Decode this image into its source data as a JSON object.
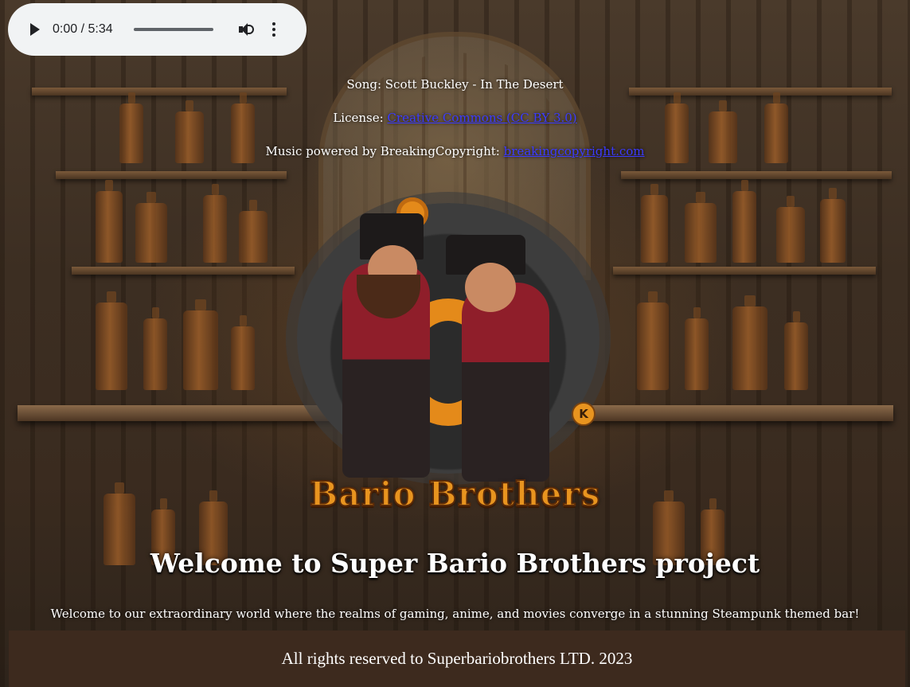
{
  "audio": {
    "time": "0:00 / 5:34",
    "play_icon": "play-icon",
    "volume_icon": "volume-icon",
    "more_icon": "more-vert-icon"
  },
  "credits": {
    "song": "Song: Scott Buckley - In The Desert",
    "license_label": "License: ",
    "license_link": "Creative Commons (CC BY 3.0)",
    "powered_label": "Music powered by BreakingCopyright: ",
    "powered_link": "breakingcopyright.com"
  },
  "logo": {
    "text": "Bario Brothers",
    "coin_letter": "K"
  },
  "main": {
    "title": "Welcome to Super Bario Brothers project",
    "intro": "Welcome to our extraordinary world where the realms of gaming, anime, and movies converge in a stunning Steampunk themed bar!"
  },
  "footer": {
    "text": "All rights reserved to Superbariobrothers LTD. 2023"
  },
  "colors": {
    "footer_bg": "#3d2a1e",
    "link": "#3b3bff",
    "logo_orange": "#e8941f"
  }
}
